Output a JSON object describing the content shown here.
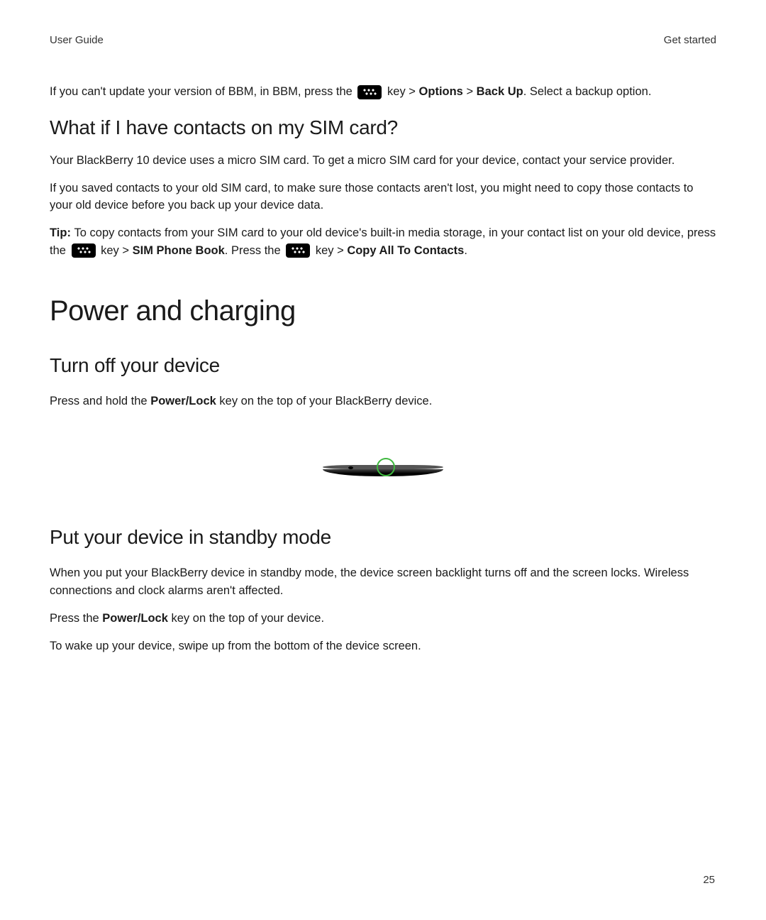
{
  "header": {
    "left": "User Guide",
    "right": "Get started"
  },
  "intro": {
    "part1": "If you can't update your version of BBM, in BBM, press the ",
    "part2": " key > ",
    "bold1": "Options",
    "part3": " > ",
    "bold2": "Back Up",
    "part4": ". Select a backup option."
  },
  "sim_heading": "What if I have contacts on my SIM card?",
  "sim_para1": "Your BlackBerry 10 device uses a micro SIM card. To get a micro SIM card for your device, contact your service provider.",
  "sim_para2": "If you saved contacts to your old SIM card, to make sure those contacts aren't lost, you might need to copy those contacts to your old device before you back up your device data.",
  "tip": {
    "label": "Tip: ",
    "part1": "To copy contacts from your SIM card to your old device's built-in media storage, in your contact list on your old device, press the ",
    "part2": " key > ",
    "bold1": "SIM Phone Book",
    "part3": ". Press the ",
    "part4": " key > ",
    "bold2": "Copy All To Contacts",
    "part5": "."
  },
  "power_heading": "Power and charging",
  "turnoff_heading": "Turn off your device",
  "turnoff_para": {
    "part1": "Press and hold the ",
    "bold": "Power/Lock",
    "part2": " key on the top of your BlackBerry device."
  },
  "standby_heading": "Put your device in standby mode",
  "standby_para1": "When you put your BlackBerry device in standby mode, the device screen backlight turns off and the screen locks. Wireless connections and clock alarms aren't affected.",
  "standby_para2": {
    "part1": "Press the ",
    "bold": "Power/Lock",
    "part2": " key on the top of your device."
  },
  "standby_para3": "To wake up your device, swipe up from the bottom of the device screen.",
  "page_number": "25"
}
